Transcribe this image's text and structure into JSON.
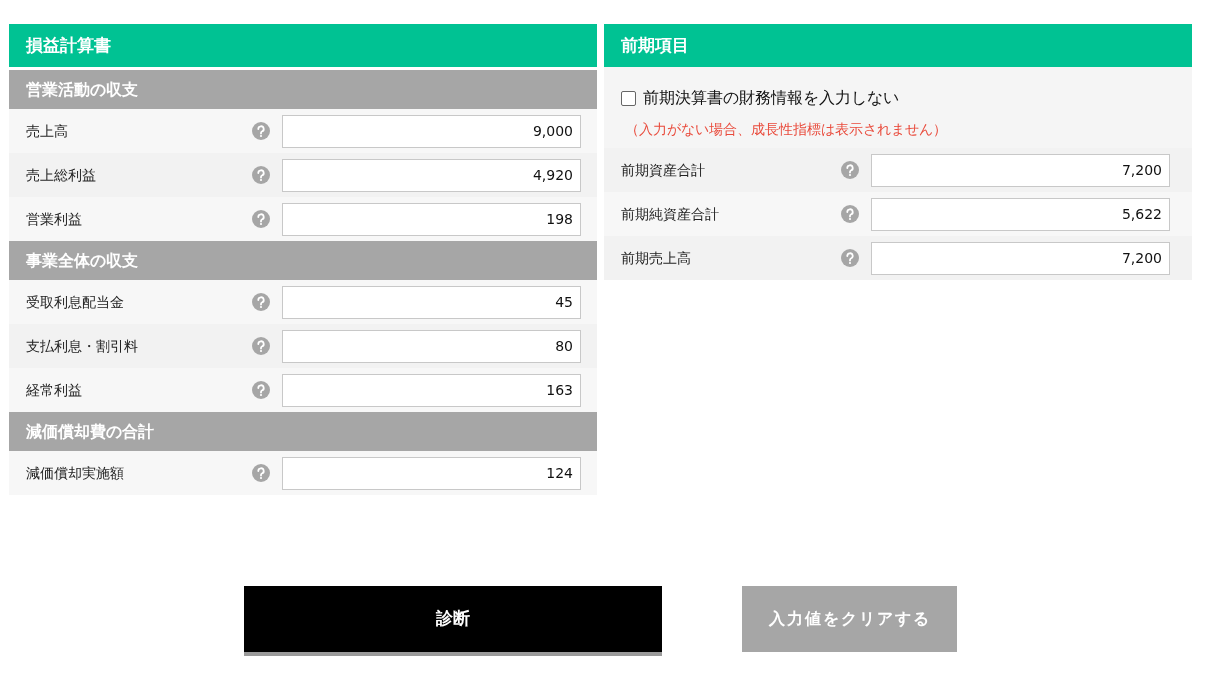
{
  "income_statement": {
    "title": "損益計算書",
    "sections": [
      {
        "heading": "営業活動の収支",
        "rows": [
          {
            "label": "売上高",
            "value": "9,000"
          },
          {
            "label": "売上総利益",
            "value": "4,920"
          },
          {
            "label": "営業利益",
            "value": "198"
          }
        ]
      },
      {
        "heading": "事業全体の収支",
        "rows": [
          {
            "label": "受取利息配当金",
            "value": "45"
          },
          {
            "label": "支払利息・割引料",
            "value": "80"
          },
          {
            "label": "経常利益",
            "value": "163"
          }
        ]
      },
      {
        "heading": "減価償却費の合計",
        "rows": [
          {
            "label": "減価償却実施額",
            "value": "124"
          }
        ]
      }
    ]
  },
  "previous_period": {
    "title": "前期項目",
    "skip_checkbox": {
      "label": "前期決算書の財務情報を入力しない",
      "checked": false
    },
    "note": "（入力がない場合、成長性指標は表示されません）",
    "rows": [
      {
        "label": "前期資産合計",
        "value": "7,200"
      },
      {
        "label": "前期純資産合計",
        "value": "5,622"
      },
      {
        "label": "前期売上高",
        "value": "7,200"
      }
    ]
  },
  "buttons": [
    {
      "label": "診断",
      "kind": "primary"
    },
    {
      "label": "入力値をクリアする",
      "kind": "secondary"
    }
  ]
}
